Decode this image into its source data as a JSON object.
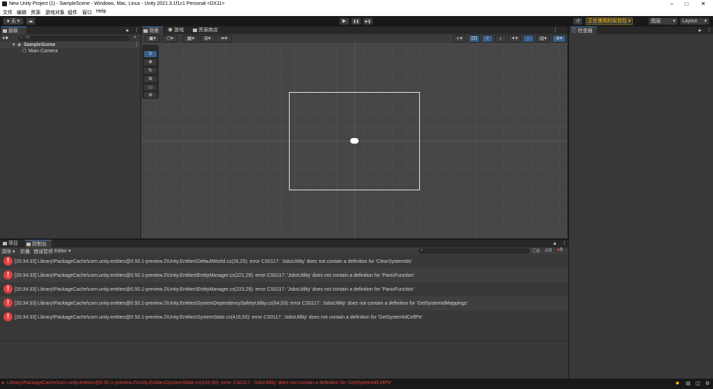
{
  "window": {
    "title": "New Unity Project (1) - SampleScene - Windows, Mac, Linux - Unity 2021.3.1f1c1 Personal <DX11>",
    "controls": [
      "–",
      "□",
      "✕"
    ]
  },
  "menu": [
    "文件",
    "编辑",
    "资源",
    "游戏对象",
    "组件",
    "窗口",
    "Help"
  ],
  "toolbar": {
    "account_label": "无",
    "cloud_icon": "cloud-icon",
    "play_icon": "▶",
    "pause_icon": "❚❚",
    "step_icon": "▶❚",
    "history_icon": "↺",
    "package_status": "正在使用的实验包 ▾",
    "layers_label": "图层",
    "layout_label": "Layout"
  },
  "hierarchy": {
    "tab_label": "层级",
    "search_placeholder": "All",
    "scene_name": "SampleScene",
    "objects": [
      "Main Camera"
    ]
  },
  "scene_view": {
    "tabs": [
      "场景",
      "游戏",
      "资源商店"
    ],
    "mode_2d": "2D"
  },
  "inspector": {
    "tab_label": "检查器"
  },
  "console": {
    "tabs": [
      "项目",
      "控制台"
    ],
    "clear_label": "清除",
    "collapse_label": "折叠",
    "error_pause_label": "错误暂停",
    "editor_label": "Editor ▾",
    "count_log": "0",
    "count_warn": "0",
    "count_error": "5",
    "entries": [
      "[20:34:33] Library\\PackageCache\\com.unity.entities@0.50.1-preview.2\\Unity.Entities\\DefaultWorld.cs(26,25): error CS0117: 'JobsUtility' does not contain a definition for 'ClearSystemIds'",
      "[20:34:33] Library\\PackageCache\\com.unity.entities@0.50.1-preview.2\\Unity.Entities\\EntityManager.cs(221,29): error CS0117: 'JobsUtility' does not contain a definition for 'PanicFunction'",
      "[20:34:33] Library\\PackageCache\\com.unity.entities@0.50.1-preview.2\\Unity.Entities\\EntityManager.cs(223,29): error CS0117: 'JobsUtility' does not contain a definition for 'PanicFunction'",
      "[20:34:33] Library\\PackageCache\\com.unity.entities@0.50.1-preview.2\\Unity.Entities\\SystemDependencySafetyUtility.cs(64,53): error CS0117: 'JobsUtility' does not contain a definition for 'GetSystemIdMappings'",
      "[20:34:33] Library\\PackageCache\\com.unity.entities@0.50.1-preview.2\\Unity.Entities\\SystemState.cs(416,50): error CS0117: 'JobsUtility' does not contain a definition for 'GetSystemIdCellPtr'"
    ]
  },
  "status": {
    "message": "Library\\PackageCache\\com.unity.entities@0.50.1-preview.2\\Unity.Entities\\SystemState.cs(416,50): error CS0117: 'JobsUtility' does not contain a definition for 'GetSystemIdCellPtr'"
  },
  "colors": {
    "error": "#e04040",
    "accent": "#3a79bb",
    "package_badge": "#ffc107"
  }
}
